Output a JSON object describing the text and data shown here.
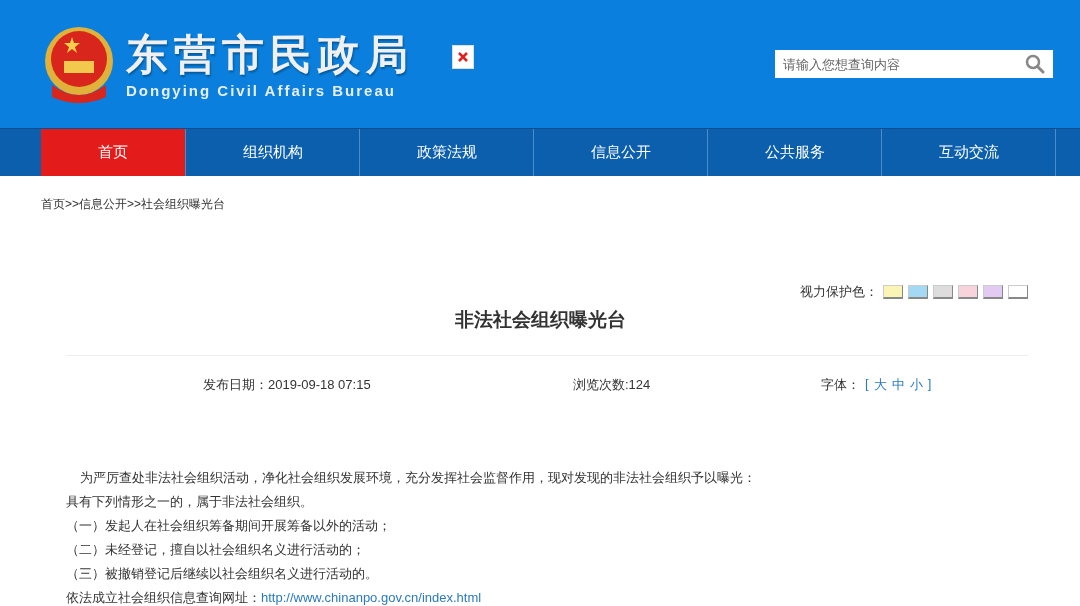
{
  "header": {
    "title": "东营市民政局",
    "subtitle": "Dongying Civil Affairs Bureau",
    "search": {
      "placeholder": "请输入您想查询内容"
    }
  },
  "nav": [
    {
      "label": "首页",
      "selected": true
    },
    {
      "label": "组织机构",
      "selected": false
    },
    {
      "label": "政策法规",
      "selected": false
    },
    {
      "label": "信息公开",
      "selected": false
    },
    {
      "label": "公共服务",
      "selected": false
    },
    {
      "label": "互动交流",
      "selected": false
    }
  ],
  "breadcrumb": "首页>>信息公开>>社会组织曝光台",
  "eye_care": {
    "label": "视力保护色：",
    "swatches": [
      {
        "color": "#faf5b4"
      },
      {
        "color": "#a3d9f3"
      },
      {
        "color": "#dddddd"
      },
      {
        "color": "#f8d3dc"
      },
      {
        "color": "#e2caf3"
      },
      {
        "color": "#ffffff"
      }
    ]
  },
  "article": {
    "title": "非法社会组织曝光台",
    "date": "发布日期：2019-09-18 07:15",
    "views": "浏览次数:124",
    "font_size": {
      "label": "字体：",
      "open": "[",
      "options": [
        "大",
        "中",
        "小"
      ],
      "close": "]"
    },
    "paragraphs": [
      "为严厉查处非法社会组织活动，净化社会组织发展环境，充分发挥社会监督作用，现对发现的非法社会组织予以曝光：",
      "具有下列情形之一的，属于非法社会组织。",
      "（一）发起人在社会组织筹备期间开展筹备以外的活动；",
      "（二）未经登记，擅自以社会组织名义进行活动的；",
      "（三）被撤销登记后继续以社会组织名义进行活动的。"
    ],
    "link_label": "依法成立社会组织信息查询网址：",
    "link": "http://www.chinanpo.gov.cn/index.html"
  }
}
